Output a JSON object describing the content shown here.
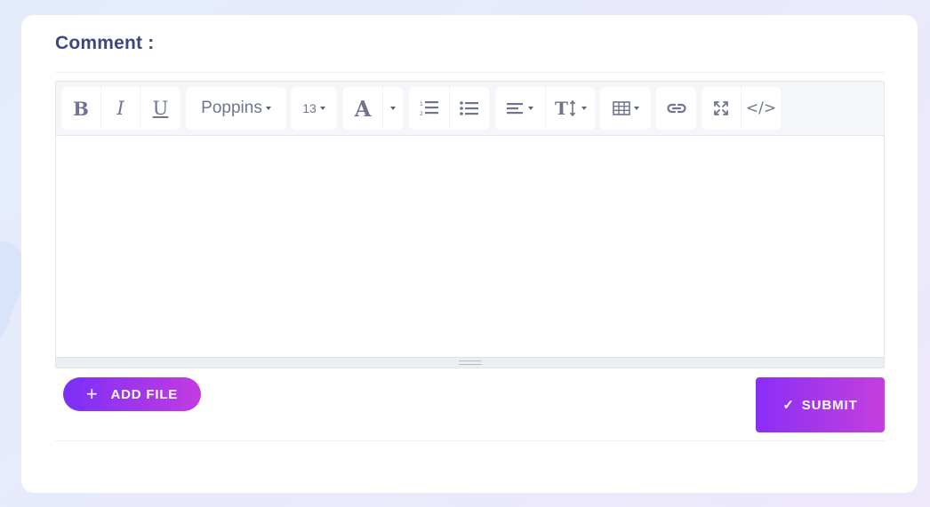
{
  "section": {
    "title": "Comment :"
  },
  "toolbar": {
    "bold": "B",
    "italic": "I",
    "underline": "U",
    "font_name": "Poppins",
    "font_size": "13",
    "font_color": "A",
    "code_view": "</>"
  },
  "buttons": {
    "add_file": "ADD FILE",
    "submit": "SUBMIT"
  },
  "icons": {
    "plus": "+",
    "check": "✓"
  },
  "colors": {
    "title": "#3d4680",
    "toolbar_icon": "#6d7590",
    "accent_start": "#7b2ff7",
    "accent_end": "#c33be0"
  }
}
